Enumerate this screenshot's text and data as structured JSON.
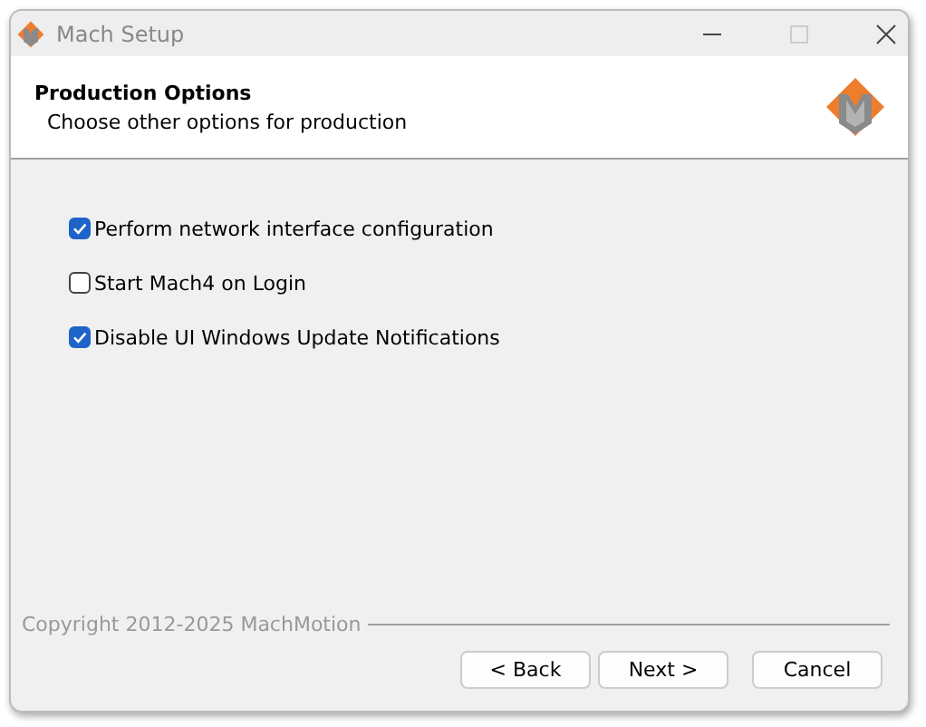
{
  "window": {
    "title": "Mach Setup"
  },
  "header": {
    "title": "Production Options",
    "subtitle": "Choose other options for production"
  },
  "options": [
    {
      "label": "Perform network interface configuration",
      "checked": true
    },
    {
      "label": "Start Mach4 on Login",
      "checked": false
    },
    {
      "label": "Disable UI Windows Update Notifications",
      "checked": true
    }
  ],
  "footer": {
    "copyright": "Copyright 2012-2025 MachMotion"
  },
  "buttons": [
    "< Back",
    "Next >",
    "Cancel"
  ]
}
